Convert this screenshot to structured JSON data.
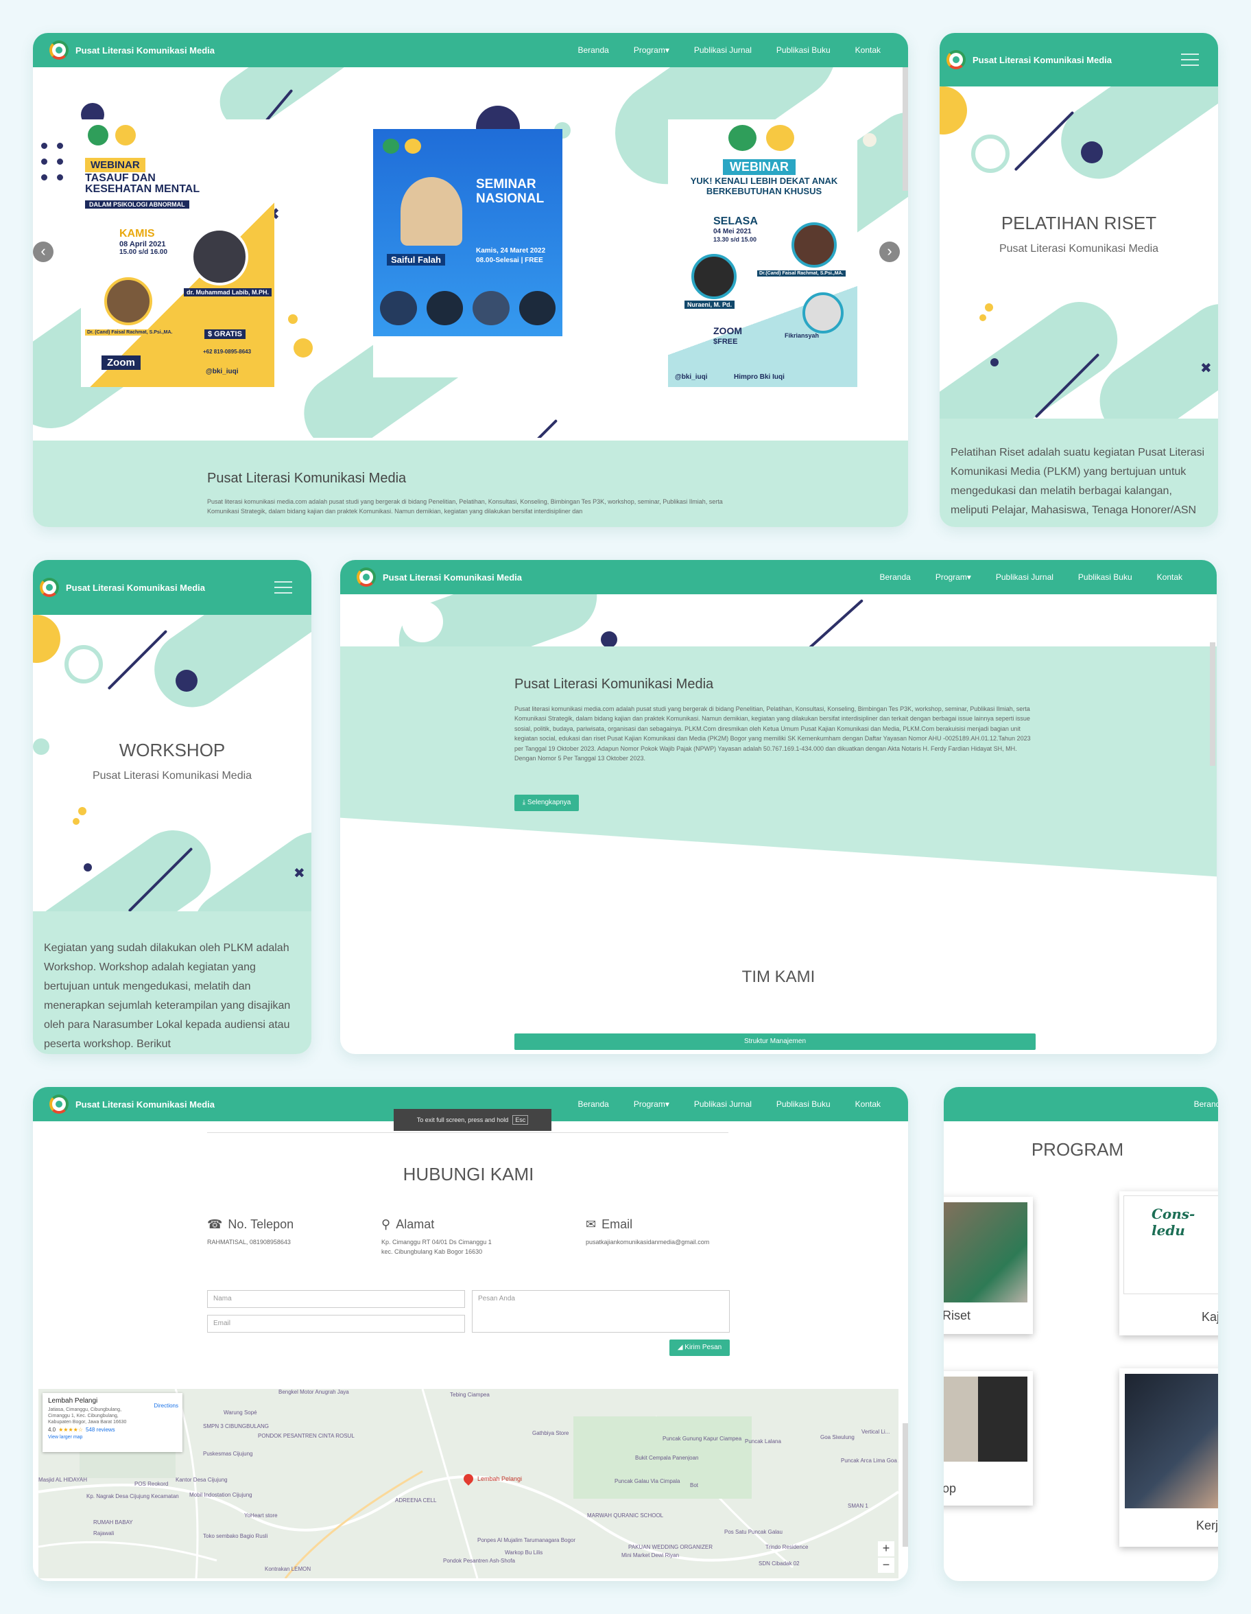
{
  "brand": "Pusat Literasi Komunikasi Media",
  "nav": {
    "beranda": "Beranda",
    "program": "Program",
    "jurnal": "Publikasi Jurnal",
    "buku": "Publikasi Buku",
    "kontak": "Kontak",
    "caret": "▾"
  },
  "hero": {
    "p1": {
      "tag": "WEBINAR",
      "title": "TASAUF DAN KESEHATAN MENTAL",
      "sub": "DALAM PSIKOLOGI ABNORMAL",
      "day": "KAMIS",
      "date": "08 April 2021",
      "time": "15.00 s/d 16.00",
      "speaker": "dr. Muhammad Labib, M.PH.",
      "moderator": "Dr. (Cand) Faisal Rachmat, S.Psi.,MA.",
      "zoom": "Zoom",
      "gratis": "$ GRATIS",
      "phone": "+62 819-0895-8643",
      "ig": "@bki_iuqi"
    },
    "p2": {
      "title": "SEMINAR NASIONAL",
      "keynote": "Saiful Falah",
      "date": "Kamis, 24 Maret 2022",
      "time": "08.00-Selesai | FREE"
    },
    "p3": {
      "tag": "WEBINAR",
      "title": "YUK! KENALI LEBIH DEKAT ANAK BERKEBUTUHAN KHUSUS",
      "day": "SELASA",
      "date": "04 Mei 2021",
      "time": "13.30 s/d 15.00",
      "s1": "Nuraeni, M. Pd.",
      "s2": "Dr.(Cand) Faisal Rachmat, S.Psi.,MA.",
      "mod": "Fikriansyah",
      "zoom": "ZOOM",
      "free": "$FREE",
      "ig": "@bki_iuqi",
      "fb": "Himpro Bki Iuqi"
    },
    "prev": "‹",
    "next": "›"
  },
  "about": {
    "title": "Pusat Literasi Komunikasi Media",
    "text1": "Pusat literasi komunikasi media.com adalah pusat studi yang bergerak di bidang Penelitian, Pelatihan, Konsultasi, Konseling, Bimbingan Tes P3K, workshop, seminar, Publikasi Ilmiah, serta Komunikasi Strategik, dalam bidang kajian dan praktek Komunikasi. Namun demikian, kegiatan yang dilakukan bersifat interdisipliner dan",
    "text2": "Pusat literasi komunikasi media.com adalah pusat studi yang bergerak di bidang Penelitian, Pelatihan, Konsultasi, Konseling, Bimbingan Tes P3K, workshop, seminar, Publikasi Ilmiah, serta Komunikasi Strategik, dalam bidang kajian dan praktek Komunikasi. Namun demikian, kegiatan yang dilakukan bersifat interdisipliner dan terkait dengan berbagai issue lainnya seperti issue sosial, politik, budaya, pariwisata, organisasi dan sebagainya. PLKM.Com diresmikan oleh Ketua Umum Pusat Kajian Komunikasi dan Media, PLKM.Com berakuisisi menjadi bagian unit kegiatan social, edukasi dan riset Pusat Kajian Komunikasi dan Media (PK2M) Bogor yang memiliki SK Kemenkumham dengan Daftar Yayasan Nomor AHU -0025189.AH.01.12.Tahun 2023 per Tanggal 19 Oktober 2023. Adapun Nomor Pokok Wajib Pajak (NPWP) Yayasan adalah 50.767.169.1-434.000 dan dikuatkan dengan Akta Notaris H. Ferdy Fardian Hidayat SH, MH. Dengan Nomor 5 Per Tanggal 13 Oktober 2023.",
    "more": "⤓ Selengkapnya"
  },
  "riset": {
    "title": "PELATIHAN RISET",
    "sub": "Pusat Literasi Komunikasi Media",
    "desc": "Pelatihan Riset adalah suatu kegiatan Pusat Literasi Komunikasi Media (PLKM) yang bertujuan untuk mengedukasi dan melatih berbagai kalangan, meliputi Pelajar, Mahasiswa, Tenaga Honorer/ASN unit Survei Pengembangan Lembaga Pemerintahan dan stakeholder-"
  },
  "workshop": {
    "title": "WORKSHOP",
    "sub": "Pusat Literasi Komunikasi Media",
    "desc": "Kegiatan yang sudah dilakukan oleh PLKM adalah Workshop. Workshop adalah kegiatan yang bertujuan untuk mengedukasi, melatih dan menerapkan sejumlah keterampilan yang disajikan oleh para Narasumber Lokal kepada audiensi atau peserta workshop. Berikut"
  },
  "team": {
    "title": "TIM KAMI",
    "button": "Struktur Manajemen"
  },
  "contact": {
    "fullscreen": "To exit full screen, press and hold",
    "esc": "Esc",
    "title": "HUBUNGI KAMI",
    "phone_label": "No. Telepon",
    "phone_value": "RAHMATISAL, 081908958643",
    "address_label": "Alamat",
    "address_1": "Kp. Cimanggu RT 04/01 Ds Cimanggu 1",
    "address_2": "kec. Cibungbulang Kab Bogor 16630",
    "email_label": "Email",
    "email_value": "pusatkajiankomunikasidanmedia@gmail.com",
    "name_ph": "Nama",
    "email_ph": "Email",
    "msg_ph": "Pesan Anda",
    "send": "◢ Kirim Pesan"
  },
  "map": {
    "place": "Lembah Pelangi",
    "addr": "Jatiasa, Cimanggu, Cibungbulang, Cimanggu 1, Kec. Cibungbulang, Kabupaten Bogor, Jawa Barat 16630",
    "rating": "4.0",
    "stars": "★★★★☆",
    "reviews": "548 reviews",
    "directions": "Directions",
    "larger": "View larger map",
    "zoom_in": "+",
    "zoom_out": "−",
    "pin": "Lembah Pelangi",
    "labels": [
      "Tebing Ciampea",
      "Warung Sopé",
      "PONDOK PESANTREN CINTA ROSUL",
      "Gathbiya Store",
      "Puncak Gunung Kapur Ciampea",
      "Puncak Lalana",
      "Goa Siwulung",
      "Puskesmas Cijujung",
      "Bukit Cempala Panenjoan",
      "Puncak Galau Via Cimpala",
      "Puncak Arca Lima Goa Aa",
      "Vertical Li...",
      "Masjid AL HIDAYAH",
      "POS Reokord",
      "Kantor Desa Cijujung",
      "Mobil Indostation Cijujung",
      "Kp. Nagrak Desa Cijujung Kecamatan",
      "ADREENA CELL",
      "Bot",
      "MARWAH QURANIC SCHOOL",
      "SMAN 1",
      "RUMAH BABAY",
      "Rajawali",
      "YoHeart store",
      "Toko sembako Bagio Rusli",
      "Ponpes Al Mujalim Tarumanagara Bogor",
      "Warkop Bu Lilis",
      "Mini Market Dewi Riyan",
      "PAKUAN WEDDING ORGANIZER",
      "Pos Satu Puncak Galau",
      "Trindo Residence",
      "SDN Cibadak 02",
      "Pondok Pesantren Ash-Shofa",
      "Kontrakan LEMON",
      "SMPN 3 CIBUNGBULANG",
      "Bengkel Motor Anugrah Jaya"
    ]
  },
  "program": {
    "nav": "Beranda",
    "title": "PROGRAM",
    "c1": "Riset",
    "c2": "Kajian",
    "c3": "op",
    "c4": "Kerj",
    "journal": "Cons-ledu"
  },
  "icons": {
    "phone": "☎",
    "pin": "⚲",
    "mail": "✉",
    "close": "✖",
    "chev": "◂"
  },
  "colors": {
    "primary": "#36b592",
    "mint": "#c4ebde",
    "navy": "#2d3067",
    "yellow": "#f7c842"
  }
}
